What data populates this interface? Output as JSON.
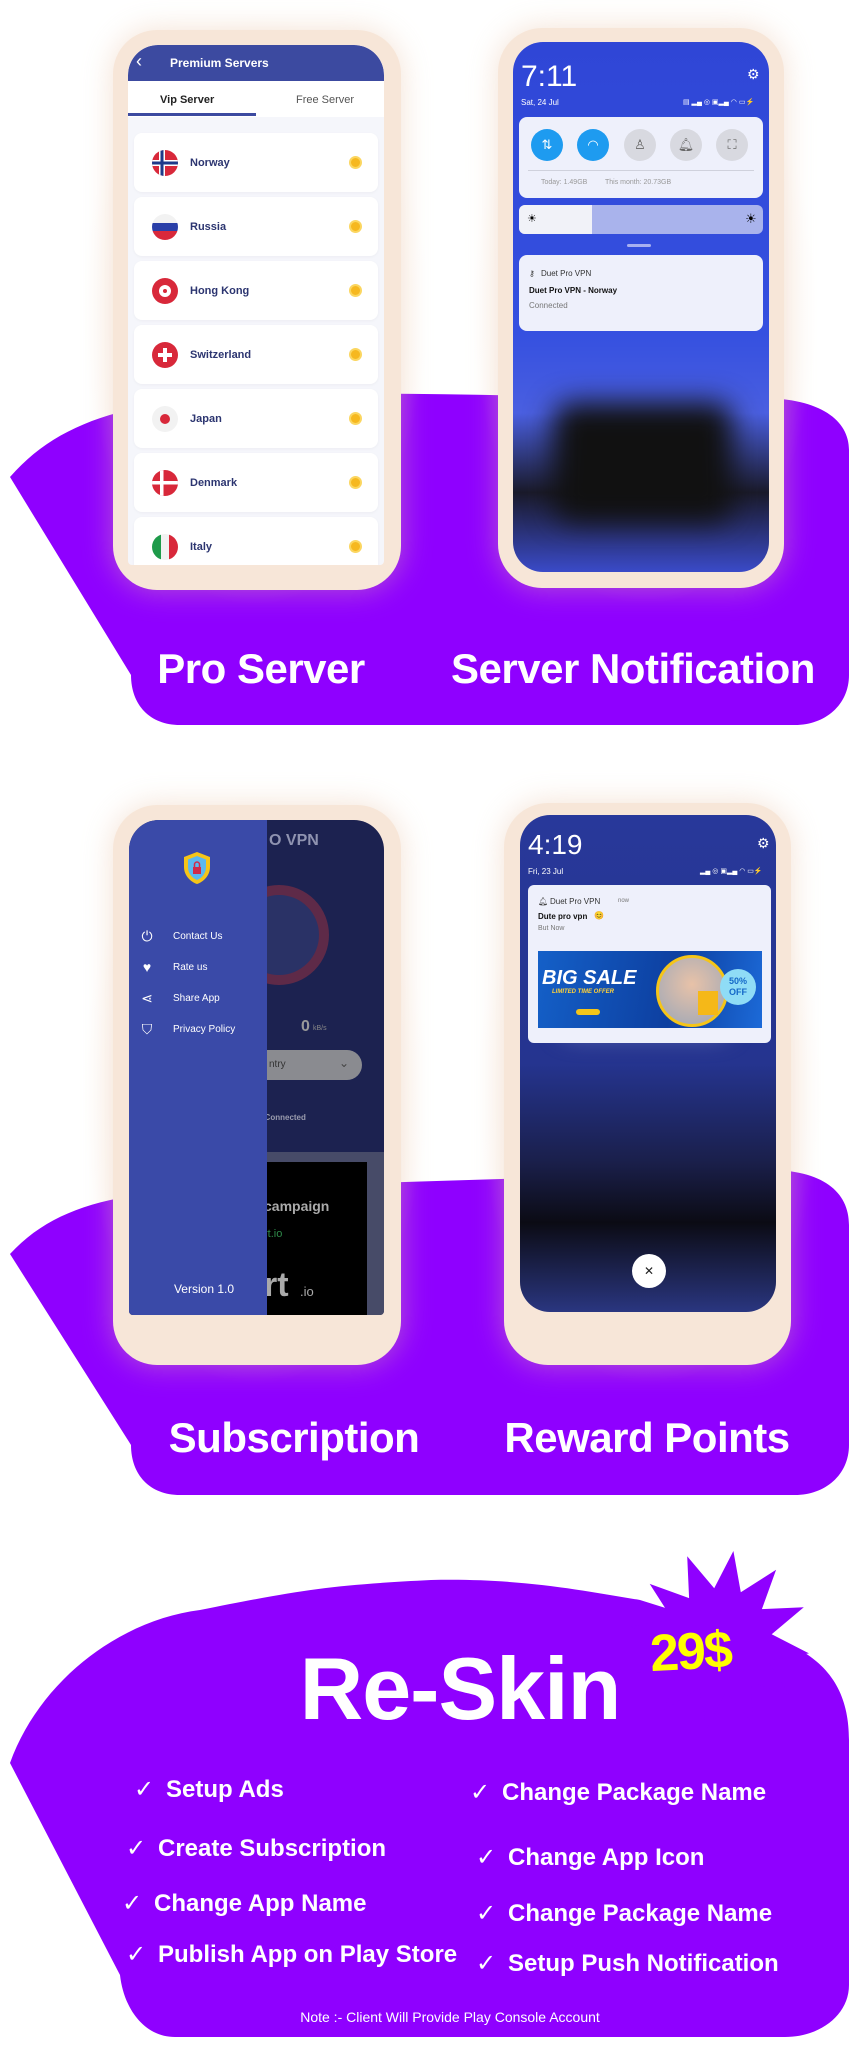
{
  "colors": {
    "purple": "#8f00ff",
    "navy": "#3c4aa0",
    "drawer": "#3a4aa8",
    "yellow": "#ffff00",
    "bezel": "#f7e6d8",
    "tile_active": "#1e9bf0"
  },
  "captions": {
    "pro_server": "Pro Server",
    "server_notification": "Server Notification",
    "subscription": "Subscription",
    "reward_points": "Reward Points"
  },
  "servers_screen": {
    "title": "Premium Servers",
    "back_icon": "chevron-left-icon",
    "tabs": [
      {
        "label": "Vip Server",
        "active": true
      },
      {
        "label": "Free Server",
        "active": false
      }
    ],
    "servers": [
      {
        "name": "Norway",
        "flag": "norway"
      },
      {
        "name": "Russia",
        "flag": "russia"
      },
      {
        "name": "Hong Kong",
        "flag": "hong-kong"
      },
      {
        "name": "Switzerland",
        "flag": "switzerland"
      },
      {
        "name": "Japan",
        "flag": "japan"
      },
      {
        "name": "Denmark",
        "flag": "denmark"
      },
      {
        "name": "Italy",
        "flag": "italy"
      }
    ],
    "premium_icon": "crown-coin-icon"
  },
  "notif_screen_1": {
    "time": "7:11",
    "date": "Sat, 24 Jul",
    "data_usage": {
      "today": "Today: 1.49GB",
      "month": "This month: 20.73GB"
    },
    "brightness": 0.3,
    "notification": {
      "app": "Duet Pro VPN",
      "title": "Duet Pro VPN - Norway",
      "body": "Connected"
    }
  },
  "drawer_screen": {
    "bg_title": "O VPN",
    "menu": [
      {
        "label": "Contact Us",
        "icon": "power-icon"
      },
      {
        "label": "Rate us",
        "icon": "heart-icon"
      },
      {
        "label": "Share App",
        "icon": "share-icon"
      },
      {
        "label": "Privacy Policy",
        "icon": "shield-icon"
      }
    ],
    "version": "Version 1.0",
    "speed_value": "0",
    "speed_unit": "kB/s",
    "country_partial": "ntry",
    "status": "Not Connected",
    "ad": {
      "line1": "campaign",
      "line2": "rt.io",
      "line3": "rt",
      "line3b": ".io"
    }
  },
  "notif_screen_2": {
    "time": "4:19",
    "date": "Fri, 23 Jul",
    "notification": {
      "app": "Duet Pro VPN",
      "when": "now",
      "title": "Dute pro vpn",
      "emoji": "😊",
      "body": "But Now"
    },
    "banner": {
      "headline": "BIG SALE",
      "sub": "LIMITED TIME OFFER",
      "badge_1": "50%",
      "badge_2": "OFF"
    }
  },
  "reskin": {
    "title": "Re-Skin",
    "price": "29$",
    "left_items": [
      "Setup Ads",
      "Create Subscription",
      "Change App Name",
      "Publish App on Play Store"
    ],
    "right_items": [
      "Change Package Name",
      "Change App Icon",
      "Change Package Name",
      "Setup Push Notification"
    ],
    "check_glyph": "✓",
    "note": "Note :- Client Will Provide Play Console Account"
  }
}
